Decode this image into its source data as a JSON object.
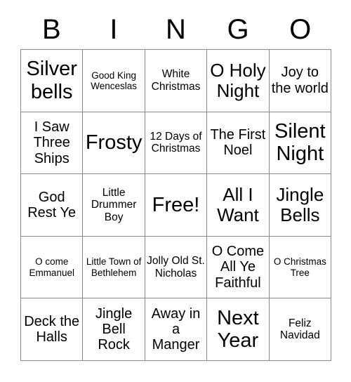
{
  "card": {
    "header_letters": [
      "B",
      "I",
      "N",
      "G",
      "O"
    ],
    "rows": [
      [
        {
          "text": "Silver bells",
          "size": "xl"
        },
        {
          "text": "Good King Wenceslas",
          "size": "xs"
        },
        {
          "text": "White Christmas",
          "size": "sm"
        },
        {
          "text": "O Holy Night",
          "size": "lg"
        },
        {
          "text": "Joy to the world",
          "size": "md"
        }
      ],
      [
        {
          "text": "I Saw Three Ships",
          "size": "md"
        },
        {
          "text": "Frosty",
          "size": "xl"
        },
        {
          "text": "12 Days of Christmas",
          "size": "sm"
        },
        {
          "text": "The First Noel",
          "size": "md"
        },
        {
          "text": "Silent Night",
          "size": "xl"
        }
      ],
      [
        {
          "text": "God Rest Ye",
          "size": "md"
        },
        {
          "text": "Little Drummer Boy",
          "size": "sm"
        },
        {
          "text": "Free!",
          "size": "xl"
        },
        {
          "text": "All I Want",
          "size": "lg"
        },
        {
          "text": "Jingle Bells",
          "size": "lg"
        }
      ],
      [
        {
          "text": "O come Emmanuel",
          "size": "xs"
        },
        {
          "text": "Little Town of Bethlehem",
          "size": "xs"
        },
        {
          "text": "Jolly Old St. Nicholas",
          "size": "sm"
        },
        {
          "text": "O Come All Ye Faithful",
          "size": "md"
        },
        {
          "text": "O Christmas Tree",
          "size": "xs"
        }
      ],
      [
        {
          "text": "Deck the Halls",
          "size": "md"
        },
        {
          "text": "Jingle Bell Rock",
          "size": "md"
        },
        {
          "text": "Away in a Manger",
          "size": "md"
        },
        {
          "text": "Next Year",
          "size": "xl"
        },
        {
          "text": "Feliz Navidad",
          "size": "sm"
        }
      ]
    ]
  },
  "colors": {
    "background": "#ffffff",
    "text": "#000000",
    "border": "#8a8a8a"
  }
}
